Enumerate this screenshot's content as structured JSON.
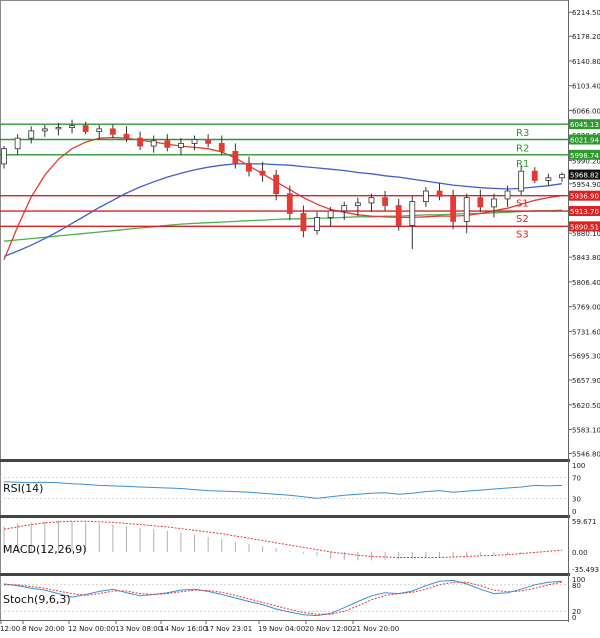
{
  "colors": {
    "up": "#2e7d32",
    "down": "#e53935",
    "ma_fast": "#e53935",
    "ma_mid": "#3f5fcf",
    "ma_slow": "#4caf50",
    "resistance": "#2e9a2e",
    "support": "#e02020",
    "rsi": "#3d8fd6",
    "macd_hist": "#b0b0b0",
    "macd_signal": "#e53935",
    "stoch_main": "#3d8fd6",
    "stoch_signal": "#e53935",
    "panel_sep": "#444444",
    "grid": "#c8c8c8"
  },
  "chart_data": [
    {
      "type": "candlestick",
      "title": "",
      "ylim": [
        5540,
        6230
      ],
      "y_ticks": [
        "6214.50",
        "6178.20",
        "6140.80",
        "6103.40",
        "6066.00",
        "6028.60",
        "5990.20",
        "5954.90",
        "5917.50",
        "5880.10",
        "5843.80",
        "5806.40",
        "5769.00",
        "5731.60",
        "5695.30",
        "5657.90",
        "5620.50",
        "5583.10",
        "5546.80"
      ],
      "x_ticks": [
        "12:00",
        "8 Nov 20:00",
        "12 Nov 00:00",
        "13 Nov 08:00",
        "14 Nov 16:00",
        "17 Nov 23:01",
        "19 Nov 04:00",
        "20 Nov 12:00",
        "21 Nov 20:00"
      ],
      "candles": [
        [
          5985,
          6012,
          5978,
          6008
        ],
        [
          6008,
          6030,
          5998,
          6024
        ],
        [
          6024,
          6042,
          6016,
          6035
        ],
        [
          6035,
          6044,
          6026,
          6038
        ],
        [
          6038,
          6047,
          6028,
          6040
        ],
        [
          6040,
          6052,
          6031,
          6043
        ],
        [
          6043,
          6049,
          6030,
          6034
        ],
        [
          6034,
          6044,
          6022,
          6038
        ],
        [
          6038,
          6045,
          6024,
          6030
        ],
        [
          6030,
          6042,
          6018,
          6024
        ],
        [
          6024,
          6034,
          6006,
          6012
        ],
        [
          6012,
          6028,
          6002,
          6020
        ],
        [
          6020,
          6030,
          6004,
          6010
        ],
        [
          6010,
          6024,
          5998,
          6016
        ],
        [
          6016,
          6028,
          6006,
          6022
        ],
        [
          6022,
          6030,
          6010,
          6016
        ],
        [
          6016,
          6028,
          5998,
          6004
        ],
        [
          6004,
          6016,
          5978,
          5986
        ],
        [
          5986,
          5996,
          5966,
          5974
        ],
        [
          5974,
          5988,
          5958,
          5968
        ],
        [
          5968,
          5976,
          5930,
          5940
        ],
        [
          5940,
          5952,
          5900,
          5910
        ],
        [
          5910,
          5922,
          5874,
          5884
        ],
        [
          5884,
          5912,
          5878,
          5904
        ],
        [
          5904,
          5920,
          5890,
          5914
        ],
        [
          5914,
          5928,
          5900,
          5922
        ],
        [
          5922,
          5934,
          5906,
          5926
        ],
        [
          5926,
          5940,
          5912,
          5934
        ],
        [
          5934,
          5944,
          5914,
          5922
        ],
        [
          5922,
          5932,
          5884,
          5892
        ],
        [
          5892,
          5936,
          5856,
          5928
        ],
        [
          5928,
          5950,
          5920,
          5944
        ],
        [
          5944,
          5956,
          5930,
          5936
        ],
        [
          5936,
          5946,
          5886,
          5898
        ],
        [
          5898,
          5940,
          5880,
          5934
        ],
        [
          5934,
          5946,
          5912,
          5920
        ],
        [
          5920,
          5940,
          5904,
          5932
        ],
        [
          5932,
          5952,
          5920,
          5944
        ],
        [
          5944,
          5982,
          5938,
          5974
        ],
        [
          5974,
          5980,
          5956,
          5960
        ],
        [
          5960,
          5970,
          5952,
          5964
        ],
        [
          5964,
          5972,
          5958,
          5968.82
        ]
      ],
      "ma_fast": [
        5840,
        5890,
        5935,
        5968,
        5992,
        6008,
        6018,
        6024,
        6025,
        6024,
        6021,
        6018,
        6015,
        6012,
        6010,
        6008,
        6003,
        5994,
        5982,
        5970,
        5958,
        5946,
        5934,
        5924,
        5916,
        5912,
        5908,
        5906,
        5905,
        5904,
        5904,
        5905,
        5906,
        5906,
        5907,
        5910,
        5914,
        5918,
        5924,
        5930,
        5934,
        5937
      ],
      "ma_mid": [
        5845,
        5853,
        5862,
        5872,
        5883,
        5895,
        5907,
        5919,
        5930,
        5941,
        5950,
        5958,
        5965,
        5971,
        5976,
        5980,
        5983,
        5985,
        5985,
        5985,
        5984,
        5983,
        5981,
        5979,
        5977,
        5975,
        5972,
        5970,
        5967,
        5965,
        5962,
        5959,
        5956,
        5953,
        5951,
        5949,
        5948,
        5947,
        5948,
        5950,
        5952,
        5955
      ],
      "ma_slow": [
        5868,
        5870,
        5872,
        5874,
        5876,
        5878,
        5880,
        5882,
        5884,
        5886,
        5888,
        5890,
        5892,
        5894,
        5895,
        5896,
        5897,
        5898,
        5899,
        5900,
        5901,
        5902,
        5902,
        5903,
        5903,
        5904,
        5905,
        5905,
        5906,
        5906,
        5907,
        5908,
        5908,
        5909,
        5910,
        5910,
        5911,
        5912,
        5913,
        5914,
        5914,
        5915
      ],
      "levels": [
        {
          "name": "R3",
          "value": 6045.13,
          "label": "6045.13",
          "kind": "resistance"
        },
        {
          "name": "R2",
          "value": 6021.94,
          "label": "6021.94",
          "kind": "resistance"
        },
        {
          "name": "R1",
          "value": 5998.74,
          "label": "5998.74",
          "kind": "resistance"
        },
        {
          "name": "S1",
          "value": 5936.9,
          "label": "5936.90",
          "kind": "support"
        },
        {
          "name": "S2",
          "value": 5913.7,
          "label": "5913.70",
          "kind": "support"
        },
        {
          "name": "S3",
          "value": 5890.51,
          "label": "5890.51",
          "kind": "support"
        }
      ],
      "current_price": {
        "value": 5968.82,
        "label": "5968.82"
      }
    },
    {
      "type": "line",
      "indicator": "RSI(14)",
      "ylim": [
        0,
        100
      ],
      "y_ticks": [
        "100",
        "70",
        "30",
        "0"
      ],
      "series": [
        {
          "values": [
            62,
            61,
            60,
            61,
            60,
            58,
            57,
            55,
            54,
            53,
            52,
            51,
            50,
            49,
            47,
            45,
            44,
            43,
            42,
            40,
            38,
            36,
            33,
            30,
            33,
            36,
            38,
            40,
            41,
            38,
            40,
            43,
            45,
            42,
            44,
            46,
            48,
            50,
            52,
            55,
            54,
            55
          ]
        }
      ]
    },
    {
      "type": "bar",
      "indicator": "MACD(12,26,9)",
      "ylim": [
        -35.493,
        59.671
      ],
      "y_ticks": [
        "59.671",
        "0.00",
        "-35.493"
      ],
      "histogram": [
        45,
        50,
        52,
        54,
        55,
        54,
        52,
        50,
        48,
        45,
        42,
        40,
        37,
        34,
        30,
        26,
        22,
        18,
        14,
        10,
        6,
        2,
        -3,
        -8,
        -12,
        -14,
        -15,
        -15,
        -14,
        -13,
        -12,
        -11,
        -10,
        -9,
        -8,
        -7,
        -6,
        -5,
        -4,
        -2,
        -1,
        0
      ],
      "signal": [
        40,
        44,
        48,
        51,
        53,
        54,
        54,
        53,
        52,
        50,
        48,
        46,
        44,
        41,
        38,
        35,
        32,
        28,
        24,
        20,
        16,
        12,
        8,
        4,
        0,
        -3,
        -6,
        -8,
        -9,
        -10,
        -10,
        -10,
        -10,
        -9,
        -8,
        -7,
        -6,
        -5,
        -3,
        -1,
        1,
        3
      ]
    },
    {
      "type": "line",
      "indicator": "Stoch(9,6,3)",
      "ylim": [
        0,
        100
      ],
      "y_ticks": [
        "100",
        "80",
        "20",
        "0"
      ],
      "series": [
        {
          "values": [
            82,
            78,
            72,
            68,
            60,
            52,
            58,
            65,
            70,
            62,
            55,
            58,
            62,
            68,
            70,
            65,
            58,
            50,
            42,
            35,
            25,
            18,
            12,
            10,
            15,
            28,
            42,
            55,
            62,
            60,
            66,
            78,
            88,
            90,
            82,
            70,
            60,
            62,
            70,
            80,
            86,
            88
          ]
        },
        {
          "values": [
            80,
            80,
            76,
            72,
            66,
            60,
            56,
            60,
            66,
            66,
            60,
            58,
            60,
            64,
            68,
            67,
            63,
            56,
            48,
            40,
            32,
            24,
            17,
            13,
            13,
            20,
            32,
            46,
            56,
            60,
            63,
            70,
            80,
            86,
            86,
            78,
            68,
            64,
            66,
            72,
            80,
            86
          ]
        }
      ]
    }
  ]
}
